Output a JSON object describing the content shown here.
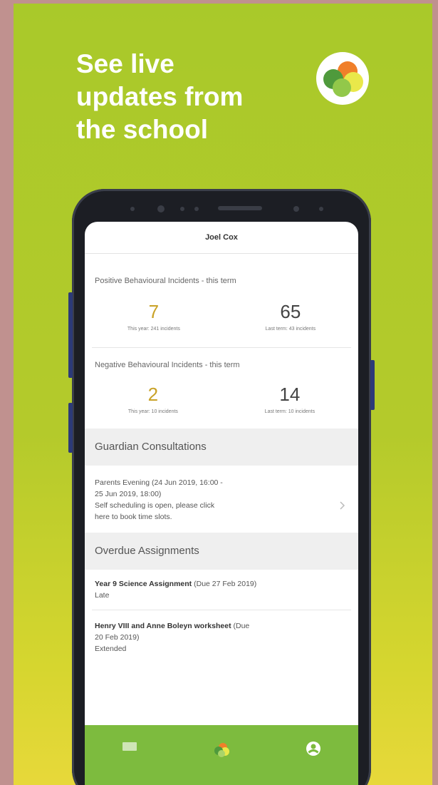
{
  "headline": {
    "line1": "See live",
    "line2": "updates from",
    "line3": "the school"
  },
  "app": {
    "user_name": "Joel Cox",
    "positive": {
      "title": "Positive Behavioural Incidents - this term",
      "left_value": "7",
      "left_caption": "This year: 241 incidents",
      "right_value": "65",
      "right_caption": "Last term: 43 incidents"
    },
    "negative": {
      "title": "Negative Behavioural Incidents - this term",
      "left_value": "2",
      "left_caption": "This year: 10 incidents",
      "right_value": "14",
      "right_caption": "Last term: 10 incidents"
    },
    "consultations": {
      "header": "Guardian Consultations",
      "line1": "Parents Evening (24 Jun 2019, 16:00 -",
      "line2": "25 Jun 2019, 18:00)",
      "line3": "Self scheduling is open, please click",
      "line4": "here to book time slots."
    },
    "assignments": {
      "header": "Overdue Assignments",
      "item1_title": "Year 9 Science Assignment",
      "item1_due": "(Due 27 Feb 2019)",
      "item1_status": "Late",
      "item2_title": "Henry VIII and Anne Boleyn worksheet",
      "item2_due": "(Due",
      "item2_due2": "20 Feb 2019)",
      "item2_status": "Extended"
    }
  },
  "icons": {
    "chevron": "chevron-right-icon",
    "logo": "school-app-logo",
    "menu": "menu-icon",
    "home": "home-logo-icon",
    "account": "account-icon"
  },
  "colors": {
    "accent_green": "#a9c92a",
    "tab_green": "#7dbb3e",
    "number_gold": "#c9a227",
    "logo_orange": "#f07f2a"
  }
}
